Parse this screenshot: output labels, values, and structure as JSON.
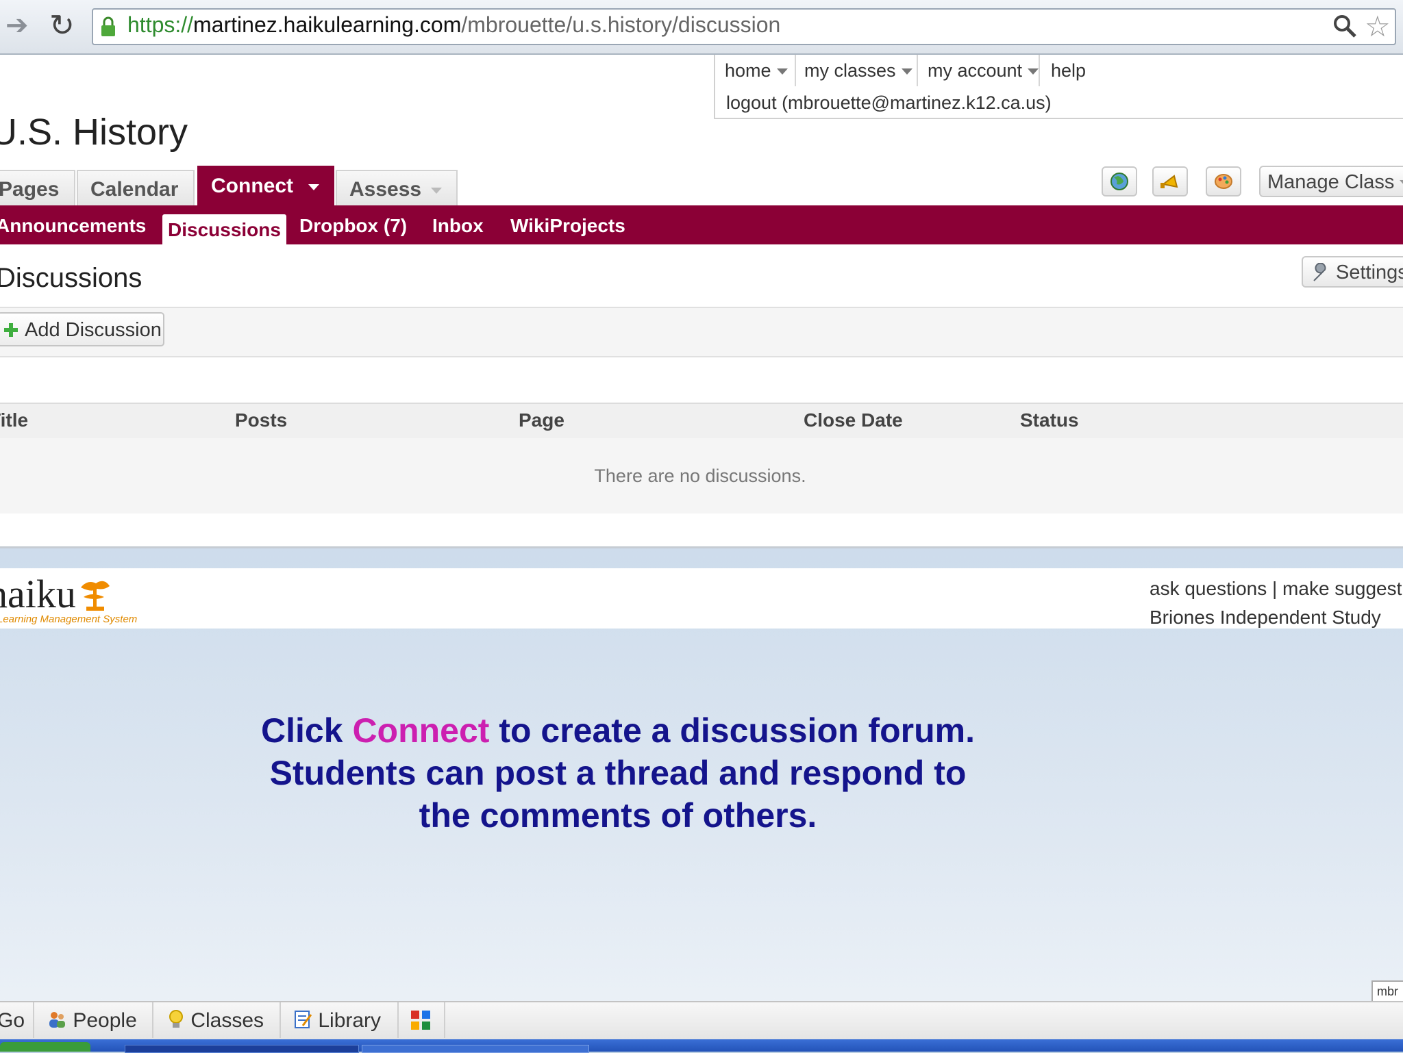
{
  "browser": {
    "url_scheme": "https://",
    "url_host": "martinez.haikulearning.com",
    "url_path": "/mbrouette/u.s.history/discussion",
    "icons": [
      "forward-icon",
      "reload-icon",
      "lock-icon",
      "search-icon",
      "star-icon"
    ]
  },
  "utility_nav": {
    "home": "home",
    "my_classes": "my classes",
    "my_account": "my account",
    "help": "help",
    "logout": "logout (mbrouette@martinez.k12.ca.us)"
  },
  "class_title": "U.S. History",
  "main_tabs": [
    {
      "label": "Pages"
    },
    {
      "label": "Calendar"
    },
    {
      "label": "Connect",
      "active": true
    },
    {
      "label": "Assess"
    }
  ],
  "actions": {
    "manage_class": "Manage Class"
  },
  "sub_nav": [
    {
      "label": "Announcements"
    },
    {
      "label": "Discussions",
      "active": true
    },
    {
      "label": "Dropbox (7)"
    },
    {
      "label": "Inbox"
    },
    {
      "label": "WikiProjects"
    }
  ],
  "discussions": {
    "heading": "Discussions",
    "settings_label": "Settings",
    "add_label": "Add Discussion",
    "columns": [
      "Title",
      "Posts",
      "Page",
      "Close Date",
      "Status"
    ],
    "empty_message": "There are no discussions."
  },
  "footer": {
    "logo_word": "haiku",
    "logo_tagline": "Learning Management System",
    "links": "ask questions | make suggestions",
    "school": "Briones Independent Study"
  },
  "caption": {
    "before": "Click ",
    "highlight": "Connect",
    "after": " to create a discussion forum. Students can post a thread and respond to the comments of others.",
    "colors": {
      "text": "#14148c",
      "highlight": "#cc1fb0"
    }
  },
  "launcher": {
    "go": "Go",
    "people": "People",
    "classes": "Classes",
    "library": "Library",
    "user_tab": "mbr"
  },
  "colors": {
    "brand": "#8b0036"
  }
}
